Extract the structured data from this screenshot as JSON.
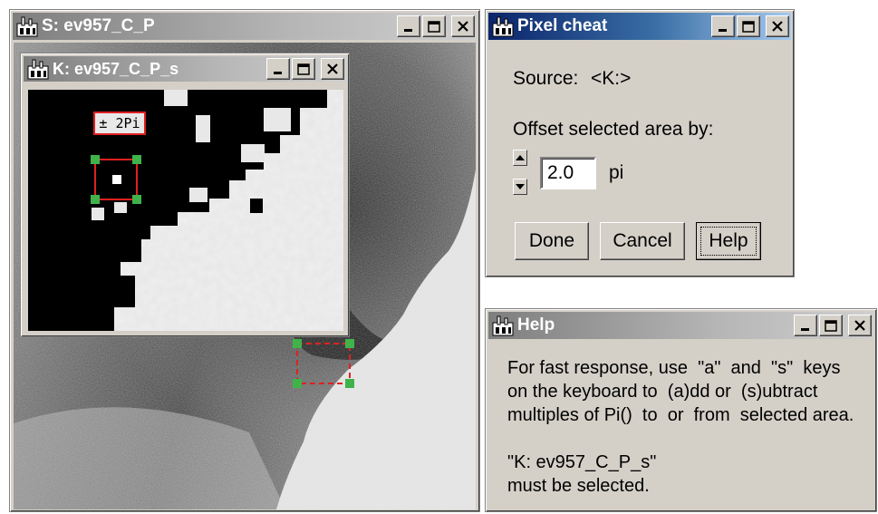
{
  "windows": {
    "s_image": {
      "title": "S: ev957_C_P"
    },
    "k_image": {
      "title": "K: ev957_C_P_s",
      "roi_label": "± 2Pi"
    },
    "pixel_cheat": {
      "title": "Pixel cheat",
      "source_label": "Source:",
      "source_value": "<K:>",
      "offset_label": "Offset selected area by:",
      "offset_value": "2.0",
      "offset_unit": "pi",
      "buttons": {
        "done": "Done",
        "cancel": "Cancel",
        "help": "Help"
      }
    },
    "help": {
      "title": "Help",
      "lines": [
        "For fast response, use  \"a\"  and  \"s\"  keys",
        "on the keyboard to  (a)dd or  (s)ubtract",
        "multiples of Pi()  to  or  from  selected area.",
        "",
        "\"K: ev957_C_P_s\"",
        "must be selected."
      ]
    }
  },
  "icons": {
    "window_icon": "app-icon",
    "minimize": "minimize-icon",
    "maximize": "maximize-icon",
    "close": "close-icon",
    "spin_up": "arrow-up-icon",
    "spin_down": "arrow-down-icon"
  },
  "colors": {
    "roi_red": "#e02020",
    "handle_green": "#3fb34a",
    "active_title": "#0a246a",
    "inactive_title": "#808080",
    "window_face": "#d4d0c8"
  }
}
